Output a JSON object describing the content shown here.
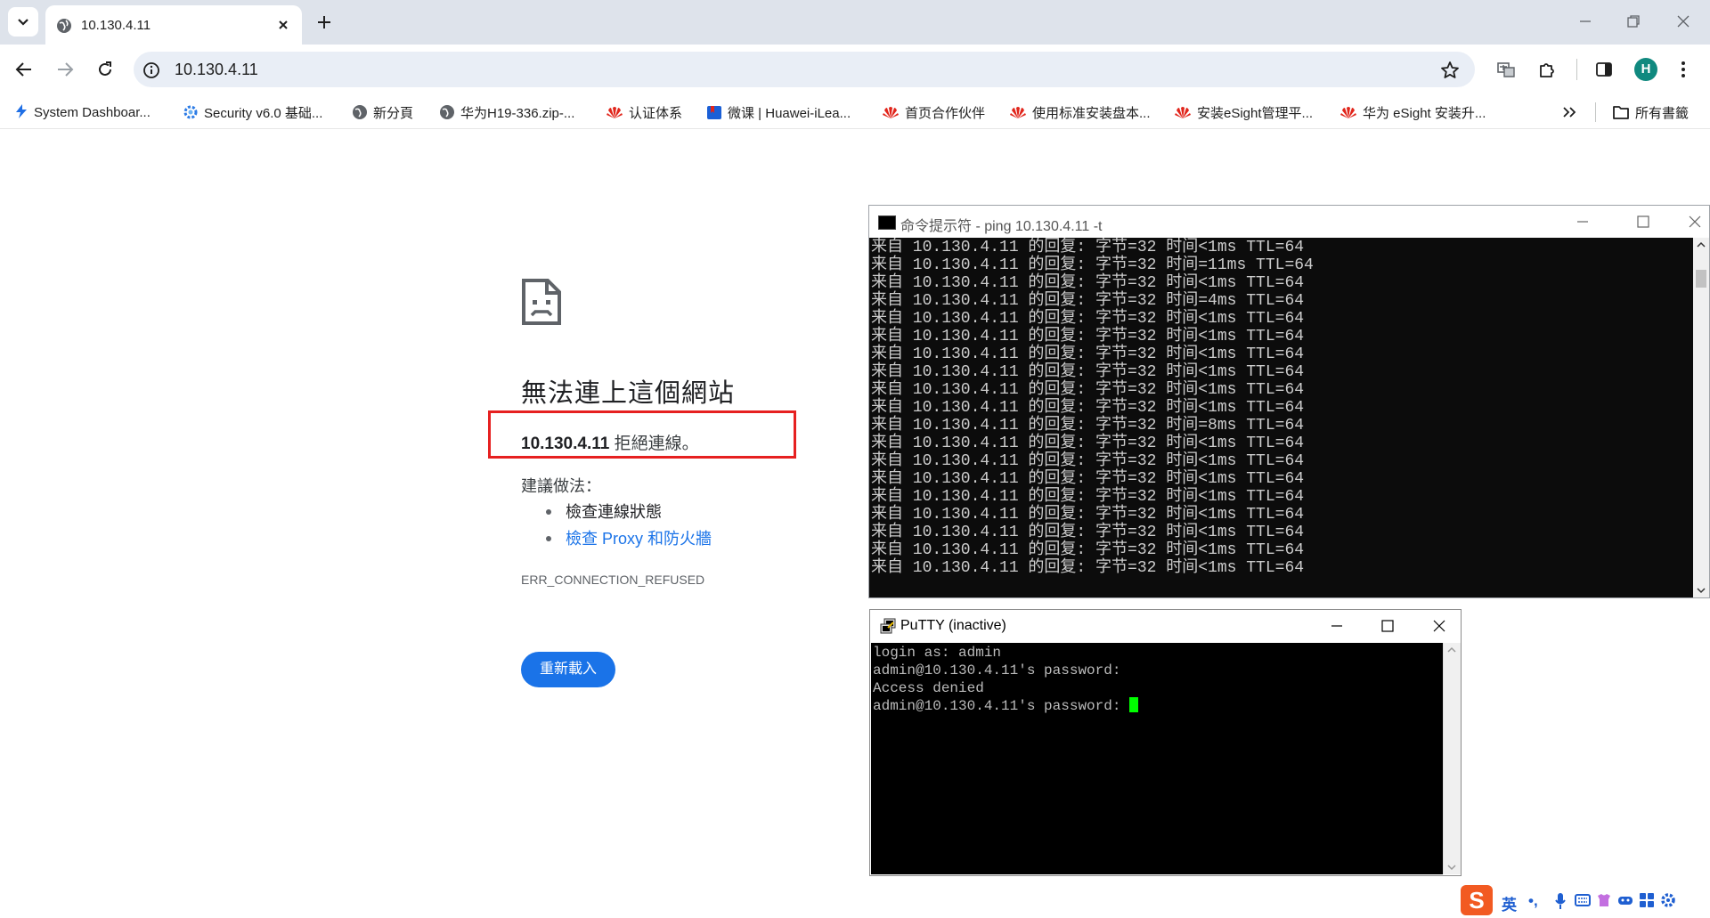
{
  "tab": {
    "title": "10.130.4.11"
  },
  "omnibox": {
    "url": "10.130.4.11"
  },
  "profile": {
    "initial": "H"
  },
  "bookmarks": [
    {
      "label": "System Dashboar...",
      "icon": "lightning-icon"
    },
    {
      "label": "Security v6.0 基础...",
      "icon": "gear-icon"
    },
    {
      "label": "新分頁",
      "icon": "globe-icon"
    },
    {
      "label": "华为H19-336.zip-...",
      "icon": "globe-icon"
    },
    {
      "label": "认证体系",
      "icon": "huawei-icon"
    },
    {
      "label": "微课 | Huawei-iLea...",
      "icon": "book-icon"
    },
    {
      "label": "首页合作伙伴",
      "icon": "huawei-icon"
    },
    {
      "label": "使用标准安装盘本...",
      "icon": "huawei-icon"
    },
    {
      "label": "安装eSight管理平...",
      "icon": "huawei-icon"
    },
    {
      "label": "华为 eSight 安装升...",
      "icon": "huawei-icon"
    }
  ],
  "bookmarks_all": "所有書籤",
  "error": {
    "title": "無法連上這個網站",
    "host": "10.130.4.11",
    "message": " 拒絕連線。",
    "suggest_label": "建議做法：",
    "suggestions": [
      "檢查連線狀態",
      "檢查 Proxy 和防火牆"
    ],
    "code": "ERR_CONNECTION_REFUSED",
    "reload_label": "重新載入"
  },
  "cmd": {
    "title": "命令提示符 - ping  10.130.4.11 -t",
    "lines": [
      "来自 10.130.4.11 的回复: 字节=32 时间<1ms TTL=64",
      "来自 10.130.4.11 的回复: 字节=32 时间=11ms TTL=64",
      "来自 10.130.4.11 的回复: 字节=32 时间<1ms TTL=64",
      "来自 10.130.4.11 的回复: 字节=32 时间=4ms TTL=64",
      "来自 10.130.4.11 的回复: 字节=32 时间<1ms TTL=64",
      "来自 10.130.4.11 的回复: 字节=32 时间<1ms TTL=64",
      "来自 10.130.4.11 的回复: 字节=32 时间<1ms TTL=64",
      "来自 10.130.4.11 的回复: 字节=32 时间<1ms TTL=64",
      "来自 10.130.4.11 的回复: 字节=32 时间<1ms TTL=64",
      "来自 10.130.4.11 的回复: 字节=32 时间<1ms TTL=64",
      "来自 10.130.4.11 的回复: 字节=32 时间=8ms TTL=64",
      "来自 10.130.4.11 的回复: 字节=32 时间<1ms TTL=64",
      "来自 10.130.4.11 的回复: 字节=32 时间<1ms TTL=64",
      "来自 10.130.4.11 的回复: 字节=32 时间<1ms TTL=64",
      "来自 10.130.4.11 的回复: 字节=32 时间<1ms TTL=64",
      "来自 10.130.4.11 的回复: 字节=32 时间<1ms TTL=64",
      "来自 10.130.4.11 的回复: 字节=32 时间<1ms TTL=64",
      "来自 10.130.4.11 的回复: 字节=32 时间<1ms TTL=64",
      "来自 10.130.4.11 的回复: 字节=32 时间<1ms TTL=64"
    ]
  },
  "putty": {
    "title": "PuTTY (inactive)",
    "lines": [
      "login as: admin",
      "admin@10.130.4.11's password:",
      "Access denied",
      "admin@10.130.4.11's password: "
    ]
  },
  "ime": {
    "lang": "英",
    "logo": "S"
  },
  "colors": {
    "accent": "#1a73e8",
    "highlight_border": "#e62020",
    "cursor": "#00ff00"
  }
}
